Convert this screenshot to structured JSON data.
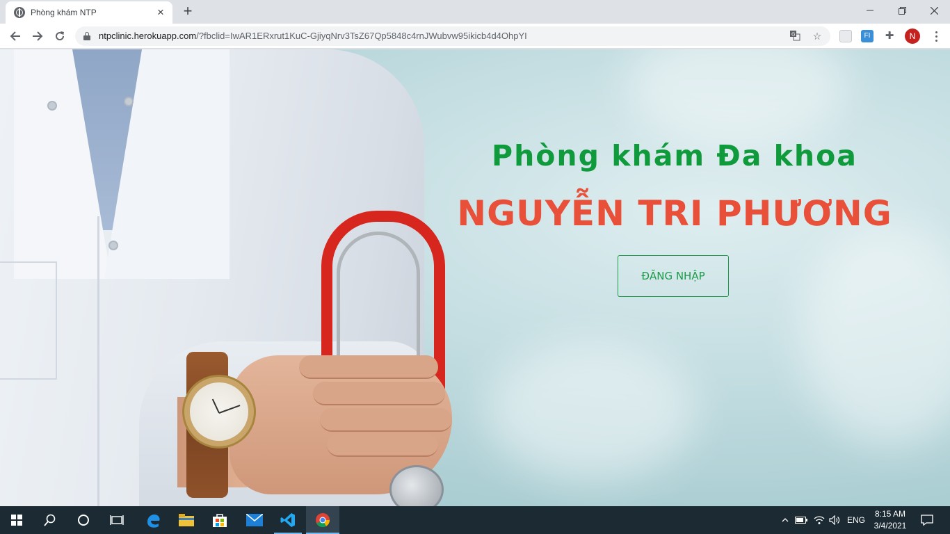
{
  "browser": {
    "tab_title": "Phòng khám NTP",
    "url_host": "ntpclinic.herokuapp.com",
    "url_path": "/?fbclid=IwAR1ERxrut1KuC-GjiyqNrv3TsZ67Qp5848c4rnJWubvw95ikicb4d4OhpYI",
    "profile_initial": "N",
    "extension_label": "FI"
  },
  "page": {
    "subtitle": "Phòng khám Đa khoa",
    "title": "NGUYỄN TRI PHƯƠNG",
    "login_button": "ĐĂNG NHẬP"
  },
  "taskbar": {
    "language": "ENG",
    "time": "8:15 AM",
    "date": "3/4/2021"
  },
  "colors": {
    "subtitle": "#0f9a3c",
    "title": "#e8503a",
    "button": "#1b9a47",
    "taskbar": "#1c2a34"
  }
}
